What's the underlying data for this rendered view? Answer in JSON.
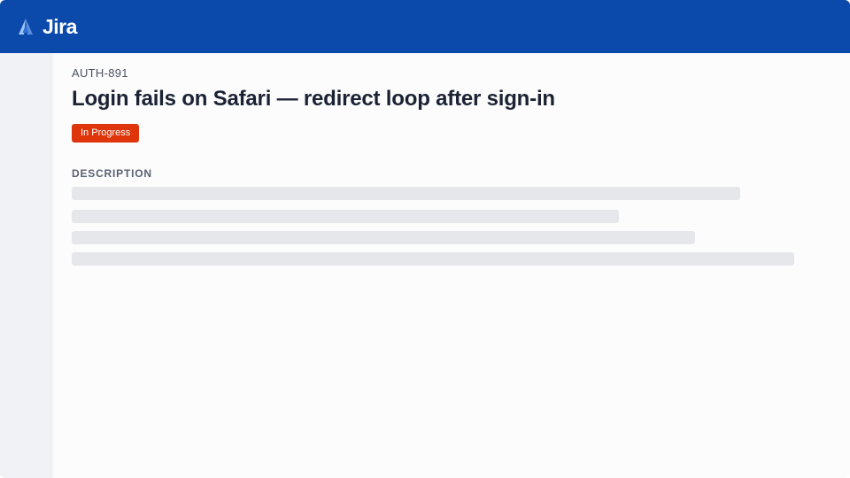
{
  "app": {
    "name": "Jira",
    "logo_icon": "jira-logo-icon",
    "brand_color": "#0b4aab"
  },
  "issue": {
    "key": "AUTH-891",
    "title": "Login fails on Safari — redirect loop after sign-in",
    "status": "In Progress",
    "status_color": "#de350b"
  },
  "description": {
    "label": "DESCRIPTION",
    "state": "loading-placeholder",
    "placeholder_line_count": 4
  }
}
